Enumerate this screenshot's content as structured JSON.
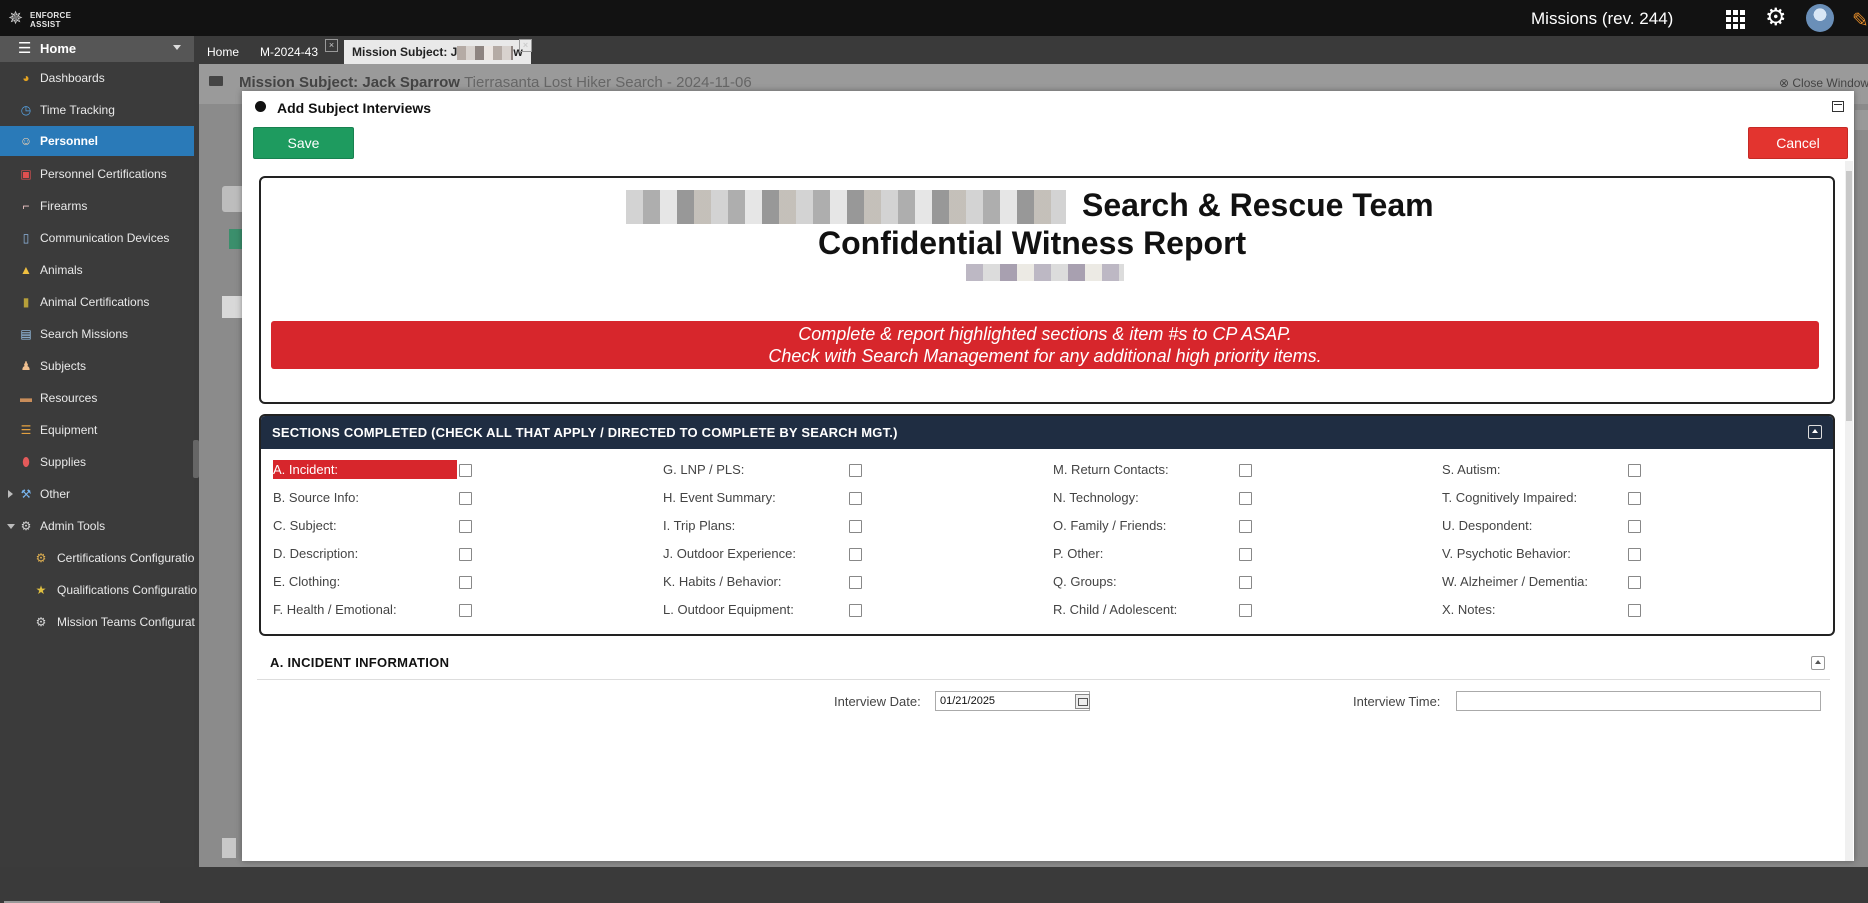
{
  "topbar": {
    "logo_text": "ENFORCE ASSIST",
    "app_title": "Missions (rev. 244)"
  },
  "sidebar": {
    "home_label": "Home",
    "items": [
      {
        "label": "Dashboards",
        "icon": "pie-chart-icon"
      },
      {
        "label": "Time Tracking",
        "icon": "clock-icon"
      },
      {
        "label": "Personnel",
        "icon": "person-icon",
        "active": true
      },
      {
        "label": "Personnel Certifications",
        "icon": "certificate-icon"
      },
      {
        "label": "Firearms",
        "icon": "gun-icon"
      },
      {
        "label": "Communication Devices",
        "icon": "radio-icon"
      },
      {
        "label": "Animals",
        "icon": "animal-icon"
      },
      {
        "label": "Animal Certifications",
        "icon": "book-icon"
      },
      {
        "label": "Search Missions",
        "icon": "document-icon"
      },
      {
        "label": "Subjects",
        "icon": "subject-icon"
      },
      {
        "label": "Resources",
        "icon": "resources-icon"
      },
      {
        "label": "Equipment",
        "icon": "equipment-icon"
      },
      {
        "label": "Supplies",
        "icon": "pill-icon"
      },
      {
        "label": "Other",
        "icon": "wrench-icon"
      },
      {
        "label": "Admin Tools",
        "icon": "gear-icon"
      },
      {
        "label": "Certifications Configuratio",
        "icon": "gear-icon"
      },
      {
        "label": "Qualifications Configuratio",
        "icon": "medal-icon"
      },
      {
        "label": "Mission Teams Configurat",
        "icon": "gear-icon"
      }
    ]
  },
  "tabs": [
    {
      "label": "Home"
    },
    {
      "label": "M-2024-43"
    },
    {
      "label": "Mission Subject: J",
      "suffix": "w"
    }
  ],
  "background_header": {
    "title": "Mission Subject: Jack Sparrow",
    "subtitle": "Tierrasanta Lost Hiker Search - 2024-11-06",
    "close_window": "Close Window"
  },
  "modal": {
    "title": "Add Subject Interviews",
    "save_label": "Save",
    "cancel_label": "Cancel",
    "report": {
      "team_title": "Search & Rescue Team",
      "report_title": "Confidential Witness Report",
      "notice_line1": "Complete & report highlighted sections & item #s to CP ASAP.",
      "notice_line2": "Check with Search Management for any additional high priority items."
    },
    "sections": {
      "heading": "SECTIONS COMPLETED (CHECK ALL THAT APPLY / DIRECTED TO COMPLETE BY SEARCH MGT.)",
      "items": [
        "A. Incident:",
        "B. Source Info:",
        "C. Subject:",
        "D. Description:",
        "E. Clothing:",
        "F. Health / Emotional:",
        "G. LNP / PLS:",
        "H. Event Summary:",
        "I. Trip Plans:",
        "J. Outdoor Experience:",
        "K. Habits / Behavior:",
        "L. Outdoor Equipment:",
        "M. Return Contacts:",
        "N. Technology:",
        "O. Family / Friends:",
        "P. Other:",
        "Q. Groups:",
        "R. Child / Adolescent:",
        "S. Autism:",
        "T. Cognitively Impaired:",
        "U. Despondent:",
        "V. Psychotic Behavior:",
        "W. Alzheimer / Dementia:",
        "X. Notes:"
      ]
    },
    "incident": {
      "heading": "A. INCIDENT INFORMATION",
      "date_label": "Interview Date:",
      "date_value": "01/21/2025",
      "time_label": "Interview Time:",
      "time_value": ""
    }
  },
  "colors": {
    "accent_blue": "#2a7ab8",
    "save_green": "#1e9b5f",
    "cancel_red": "#e3342f",
    "notice_red": "#d7262c",
    "section_header": "#1f2d42"
  }
}
